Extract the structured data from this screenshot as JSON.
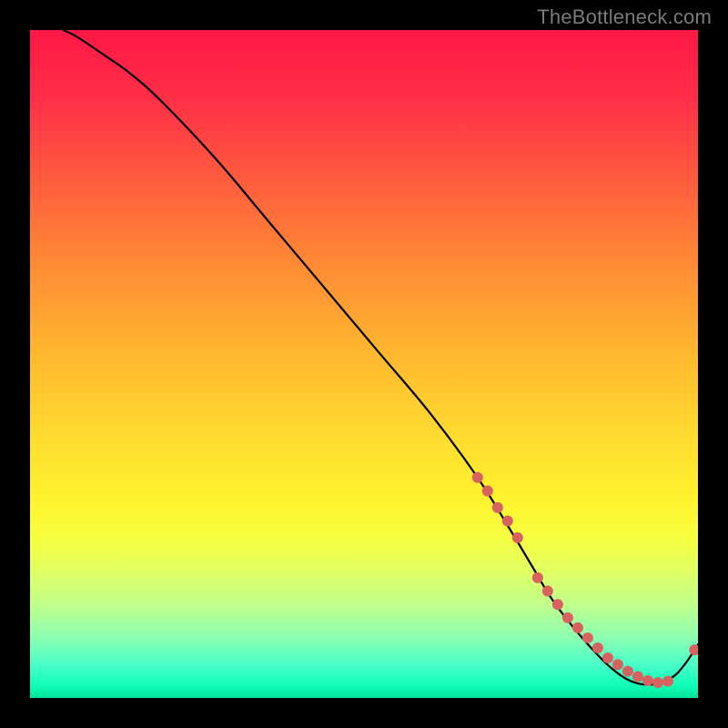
{
  "watermark": {
    "text": "TheBottleneck.com"
  },
  "chart_data": {
    "type": "line",
    "title": "",
    "xlabel": "",
    "ylabel": "",
    "xlim": [
      0,
      100
    ],
    "ylim": [
      0,
      100
    ],
    "grid": false,
    "series": [
      {
        "name": "curve",
        "color": "#000000",
        "x": [
          5,
          7,
          10,
          15,
          20,
          28,
          36,
          44,
          52,
          60,
          67,
          72,
          75,
          78,
          81,
          84,
          87,
          90,
          93,
          96,
          98,
          100
        ],
        "y": [
          100,
          99,
          97,
          93.5,
          89,
          80.5,
          71,
          61.5,
          52,
          42.5,
          33,
          25,
          20,
          15,
          11,
          7.5,
          4.5,
          2.5,
          2,
          3,
          5,
          8
        ]
      }
    ],
    "annotations": [
      {
        "type": "points",
        "name": "highlight-dots",
        "color": "#d8625f",
        "radius_px": 6,
        "x": [
          67,
          68.5,
          70,
          71.5,
          73,
          76,
          77.5,
          79,
          80.5,
          82,
          83.5,
          85,
          86.5,
          88,
          89.5,
          91,
          92.5,
          94,
          95.5,
          99.5
        ],
        "y": [
          33,
          31,
          28.5,
          26.5,
          24,
          18,
          16,
          14,
          12,
          10.5,
          9,
          7.5,
          6,
          5,
          4,
          3.2,
          2.6,
          2.3,
          2.5,
          7.2
        ]
      }
    ],
    "background": {
      "type": "vertical-gradient",
      "stops": [
        {
          "pos": 0.0,
          "color": "#ff1846"
        },
        {
          "pos": 0.35,
          "color": "#ff8a35"
        },
        {
          "pos": 0.6,
          "color": "#ffd930"
        },
        {
          "pos": 0.8,
          "color": "#e1ff63"
        },
        {
          "pos": 0.95,
          "color": "#4affc9"
        },
        {
          "pos": 1.0,
          "color": "#00e59a"
        }
      ]
    }
  }
}
